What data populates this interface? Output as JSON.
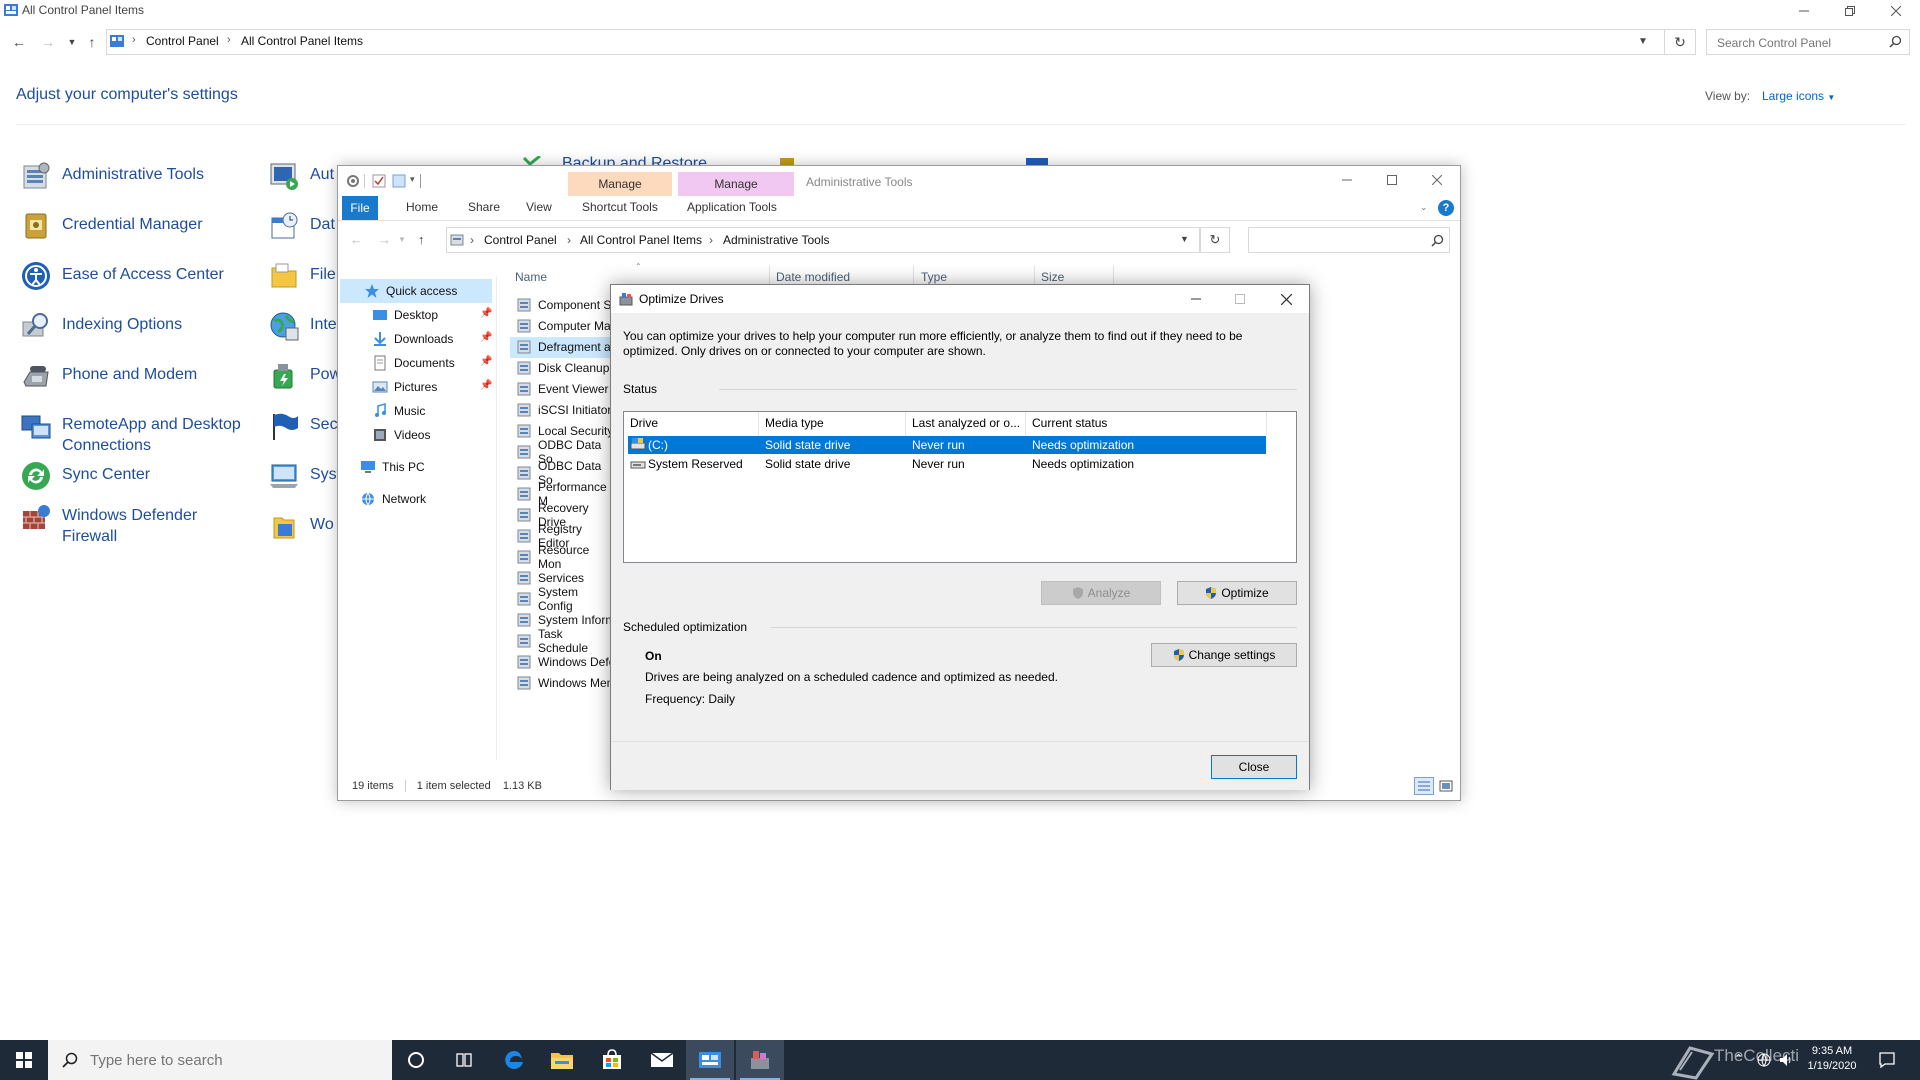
{
  "control_panel": {
    "title": "All Control Panel Items",
    "breadcrumb": [
      "Control Panel",
      "All Control Panel Items"
    ],
    "search_placeholder": "Search Control Panel",
    "heading": "Adjust your computer's settings",
    "view_by_label": "View by:",
    "view_by_value": "Large icons",
    "items_col1": [
      {
        "label": "Administrative Tools",
        "icon": "admin-tools-icon"
      },
      {
        "label": "Credential Manager",
        "icon": "credential-manager-icon"
      },
      {
        "label": "Ease of Access Center",
        "icon": "ease-of-access-icon"
      },
      {
        "label": "Indexing Options",
        "icon": "indexing-options-icon"
      },
      {
        "label": "Phone and Modem",
        "icon": "phone-modem-icon"
      },
      {
        "label": "RemoteApp and Desktop Connections",
        "icon": "remoteapp-icon"
      },
      {
        "label": "Sync Center",
        "icon": "sync-center-icon"
      },
      {
        "label": "Windows Defender Firewall",
        "icon": "firewall-icon"
      }
    ],
    "items_col2": [
      {
        "label": "Aut",
        "icon": "autoplay-icon"
      },
      {
        "label": "Dat",
        "icon": "date-time-icon"
      },
      {
        "label": "File",
        "icon": "file-explorer-options-icon"
      },
      {
        "label": "Inte",
        "icon": "internet-options-icon"
      },
      {
        "label": "Pow",
        "icon": "power-options-icon"
      },
      {
        "label": "Sec",
        "icon": "security-maintenance-icon"
      },
      {
        "label": "Syst",
        "icon": "system-icon"
      },
      {
        "label": "Wo",
        "icon": "work-folders-icon"
      }
    ],
    "partial_item_behind": "Backup and Restore"
  },
  "explorer": {
    "title": "Administrative Tools",
    "ctx_tab_1": "Manage",
    "ctx_tab_2": "Manage",
    "tabs": {
      "file": "File",
      "home": "Home",
      "share": "Share",
      "view": "View",
      "shortcut_tools": "Shortcut Tools",
      "application_tools": "Application Tools"
    },
    "breadcrumb": [
      "Control Panel",
      "All Control Panel Items",
      "Administrative Tools"
    ],
    "columns": {
      "name": "Name",
      "date_modified": "Date modified",
      "type": "Type",
      "size": "Size"
    },
    "nav": {
      "quick_access": "Quick access",
      "desktop": "Desktop",
      "downloads": "Downloads",
      "documents": "Documents",
      "pictures": "Pictures",
      "music": "Music",
      "videos": "Videos",
      "this_pc": "This PC",
      "network": "Network"
    },
    "files": [
      "Component S",
      "Computer Ma",
      "Defragment a",
      "Disk Cleanup",
      "Event Viewer",
      "iSCSI Initiator",
      "Local Security",
      "ODBC Data So",
      "ODBC Data So",
      "Performance M",
      "Recovery Drive",
      "Registry Editor",
      "Resource Mon",
      "Services",
      "System Config",
      "System Inform",
      "Task Schedule",
      "Windows Defe",
      "Windows Men"
    ],
    "status": {
      "items": "19 items",
      "selected": "1 item selected",
      "size": "1.13 KB"
    }
  },
  "dialog": {
    "title": "Optimize Drives",
    "description": "You can optimize your drives to help your computer run more efficiently, or analyze them to find out if they need to be optimized. Only drives on or connected to your computer are shown.",
    "status_label": "Status",
    "columns": {
      "drive": "Drive",
      "media_type": "Media type",
      "last_analyzed": "Last analyzed or o...",
      "current_status": "Current status"
    },
    "drives": [
      {
        "drive": "(C:)",
        "media_type": "Solid state drive",
        "last_analyzed": "Never run",
        "current_status": "Needs optimization"
      },
      {
        "drive": "System Reserved",
        "media_type": "Solid state drive",
        "last_analyzed": "Never run",
        "current_status": "Needs optimization"
      }
    ],
    "analyze_button": "Analyze",
    "optimize_button": "Optimize",
    "scheduled_label": "Scheduled optimization",
    "scheduled_state": "On",
    "scheduled_desc": "Drives are being analyzed on a scheduled cadence and optimized as needed.",
    "frequency": "Frequency: Daily",
    "change_settings_button": "Change settings",
    "close_button": "Close"
  },
  "taskbar": {
    "search_placeholder": "Type here to search",
    "time": "9:35 AM",
    "date": "1/19/2020",
    "watermark": "TheCollectionBook"
  },
  "colors": {
    "accent": "#0078d7",
    "link": "#1e4e9a",
    "taskbar": "#1f2a38",
    "ctx_manage_1": "#fdd9bd",
    "ctx_manage_2": "#f0c8f2"
  }
}
